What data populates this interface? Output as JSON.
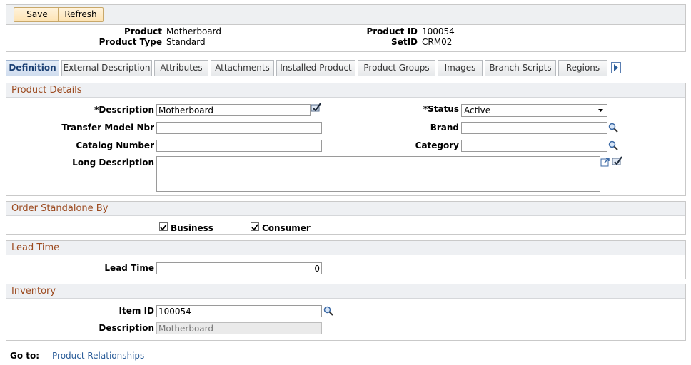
{
  "toolbar": {
    "save_label": "Save",
    "refresh_label": "Refresh"
  },
  "header": {
    "product_label": "Product",
    "product_value": "Motherboard",
    "product_type_label": "Product Type",
    "product_type_value": "Standard",
    "product_id_label": "Product ID",
    "product_id_value": "100054",
    "setid_label": "SetID",
    "setid_value": "CRM02"
  },
  "tabs": [
    {
      "label": "Definition"
    },
    {
      "label": "External Description"
    },
    {
      "label": "Attributes"
    },
    {
      "label": "Attachments"
    },
    {
      "label": "Installed Product"
    },
    {
      "label": "Product Groups"
    },
    {
      "label": "Images"
    },
    {
      "label": "Branch Scripts"
    },
    {
      "label": "Regions"
    }
  ],
  "product_details": {
    "title": "Product Details",
    "description_label": "*Description",
    "description_value": "Motherboard",
    "status_label": "*Status",
    "status_value": "Active",
    "transfer_model_label": "Transfer Model Nbr",
    "transfer_model_value": "",
    "brand_label": "Brand",
    "brand_value": "",
    "catalog_number_label": "Catalog Number",
    "catalog_number_value": "",
    "category_label": "Category",
    "category_value": "",
    "long_description_label": "Long Description",
    "long_description_value": ""
  },
  "order_standalone": {
    "title": "Order Standalone By",
    "business_label": "Business",
    "business_checked": true,
    "consumer_label": "Consumer",
    "consumer_checked": true
  },
  "lead_time": {
    "title": "Lead Time",
    "lead_time_label": "Lead Time",
    "lead_time_value": "0"
  },
  "inventory": {
    "title": "Inventory",
    "item_id_label": "Item ID",
    "item_id_value": "100054",
    "description_label": "Description",
    "description_value": "Motherboard"
  },
  "footer": {
    "goto_label": "Go to:",
    "product_relationships_link": "Product Relationships"
  },
  "colors": {
    "section_title": "#9c4a1f",
    "link": "#2b5d99",
    "active_tab_text": "#1a3f73"
  },
  "icons": [
    "lookup-icon",
    "spell-check-icon",
    "expand-icon",
    "tab-next-icon"
  ]
}
